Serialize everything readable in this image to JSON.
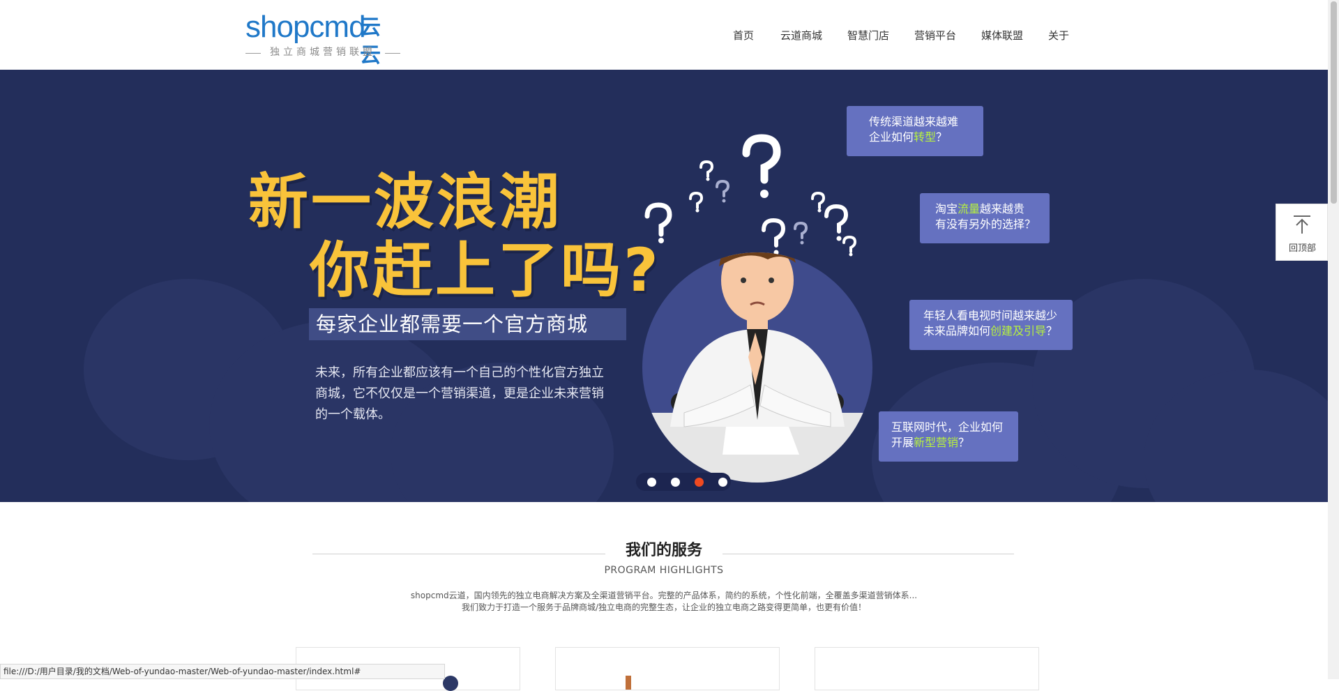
{
  "logo": {
    "wordmark": "shopcmd",
    "cn": "云云",
    "tagline": "独立商城营销联盟"
  },
  "nav": [
    {
      "label": "首页"
    },
    {
      "label": "云道商城"
    },
    {
      "label": "智慧门店"
    },
    {
      "label": "营销平台"
    },
    {
      "label": "媒体联盟"
    },
    {
      "label": "关于"
    }
  ],
  "hero": {
    "headline_1": "新一波浪潮",
    "headline_2": "你赶上了吗?",
    "subtitle": "每家企业都需要一个官方商城",
    "description": "未来，所有企业都应该有一个自己的个性化官方独立商城，它不仅仅是一个营销渠道，更是企业未来营销的一个载体。",
    "bubbles": [
      {
        "l1": "传统渠道越来越难",
        "l2_pre": "企业如何",
        "l2_hl": "转型",
        "l2_post": "？"
      },
      {
        "l1_pre": "淘宝",
        "l1_hl": "流量",
        "l1_post": "越来越贵",
        "l2": "有没有另外的选择？"
      },
      {
        "l1": "年轻人看电视时间越来越少",
        "l2_pre": "未来品牌如何",
        "l2_hl": "创建及引导",
        "l2_post": "？"
      },
      {
        "l1": "互联网时代，企业如何",
        "l2_pre": "开展",
        "l2_hl": "新型营销",
        "l2_post": "？"
      }
    ],
    "carousel": {
      "count": 4,
      "active_index": 3
    },
    "colors": {
      "background": "#232e5b",
      "headline": "#f9c33a",
      "bubble": "#6571c0",
      "highlight": "#b8f23d",
      "active_dot": "#f04a20"
    }
  },
  "services": {
    "title": "我们的服务",
    "subtitle": "PROGRAM HIGHLIGHTS",
    "intro_1": "shopcmd云道，国内领先的独立电商解决方案及全渠道营销平台。完整的产品体系，简约的系统，个性化前端，全覆盖多渠道营销体系...",
    "intro_2": "我们致力于打造一个服务于品牌商城/独立电商的完整生态，让企业的独立电商之路变得更简单，也更有价值！"
  },
  "back_to_top": {
    "label": "回顶部",
    "icon": "arrow-up-icon"
  },
  "status_bar": {
    "url": "file:///D:/用户目录/我的文档/Web-of-yundao-master/Web-of-yundao-master/index.html#"
  }
}
